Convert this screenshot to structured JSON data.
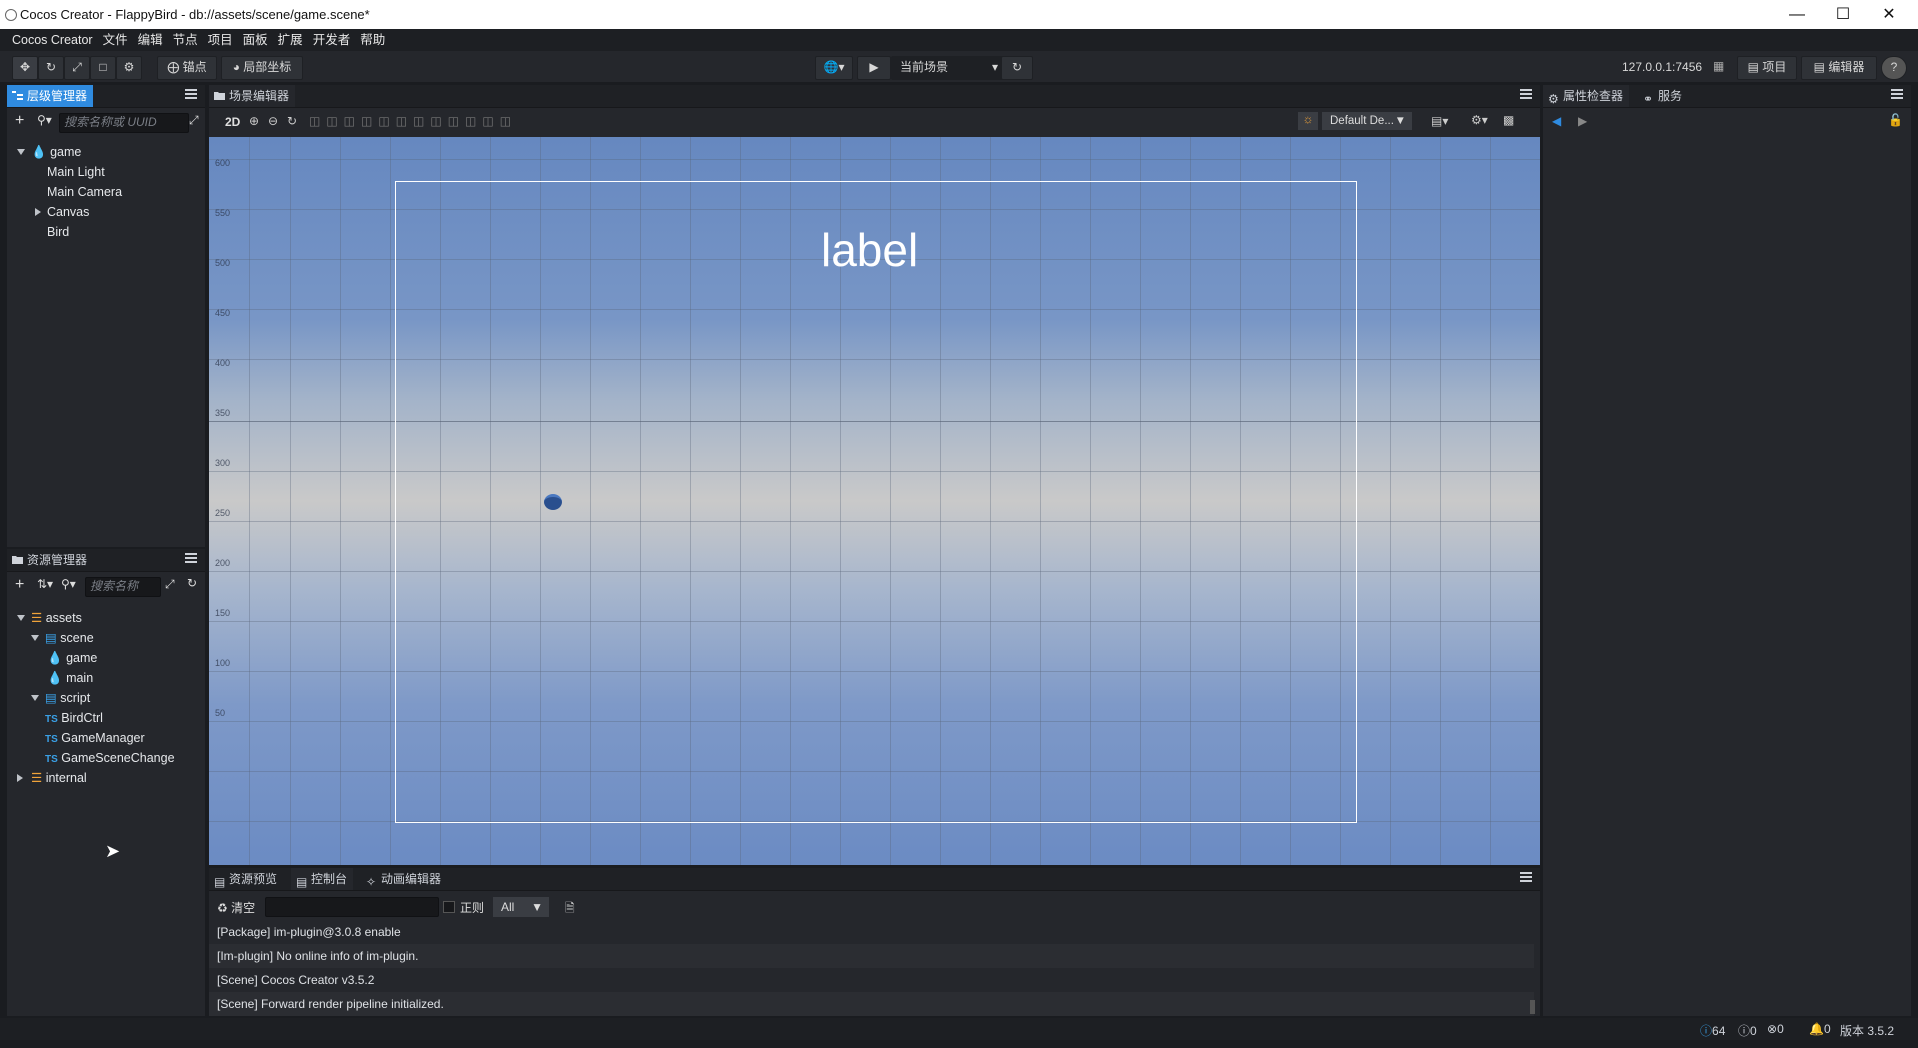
{
  "window": {
    "title": "Cocos Creator - FlappyBird - db://assets/scene/game.scene*"
  },
  "menu": [
    "Cocos Creator",
    "文件",
    "编辑",
    "节点",
    "项目",
    "面板",
    "扩展",
    "开发者",
    "帮助"
  ],
  "toolbar": {
    "pivot_label": "锚点",
    "local_label": "局部坐标",
    "scene_select": "当前场景",
    "server": "127.0.0.1:7456",
    "project_label": "项目",
    "editor_label": "编辑器"
  },
  "hierarchy": {
    "tab": "层级管理器",
    "search_placeholder": "搜索名称或 UUID",
    "nodes": [
      "game",
      "Main Light",
      "Main Camera",
      "Canvas",
      "Bird"
    ]
  },
  "assets": {
    "tab": "资源管理器",
    "search_placeholder": "搜索名称",
    "items": [
      "assets",
      "scene",
      "game",
      "main",
      "script",
      "BirdCtrl",
      "GameManager",
      "GameSceneChange",
      "internal"
    ],
    "ts_badge": "TS"
  },
  "scene_editor": {
    "tab": "场景编辑器",
    "mode_2d": "2D",
    "layout_select": "Default De...",
    "canvas_label": "label",
    "y_ticks": [
      "600",
      "550",
      "500",
      "450",
      "400",
      "350",
      "300",
      "250",
      "200",
      "150",
      "100",
      "50"
    ]
  },
  "inspector": {
    "tab": "属性检查器",
    "service_tab": "服务"
  },
  "bottom_tabs": [
    "资源预览",
    "控制台",
    "动画编辑器"
  ],
  "console": {
    "clear_label": "清空",
    "regex_label": "正则",
    "filter_value": "All",
    "lines": [
      "[Package] im-plugin@3.0.8 enable",
      "[Im-plugin] No online info of im-plugin.",
      "[Scene] Cocos Creator v3.5.2",
      "[Scene] Forward render pipeline initialized."
    ]
  },
  "status": {
    "info_count": "64",
    "warn_count": "0",
    "error_count": "0",
    "notify_count": "0",
    "version": "版本 3.5.2"
  },
  "colors": {
    "accent": "#2f8be0",
    "scene_bg": "#6688c0",
    "folder": "#f0a33a"
  }
}
